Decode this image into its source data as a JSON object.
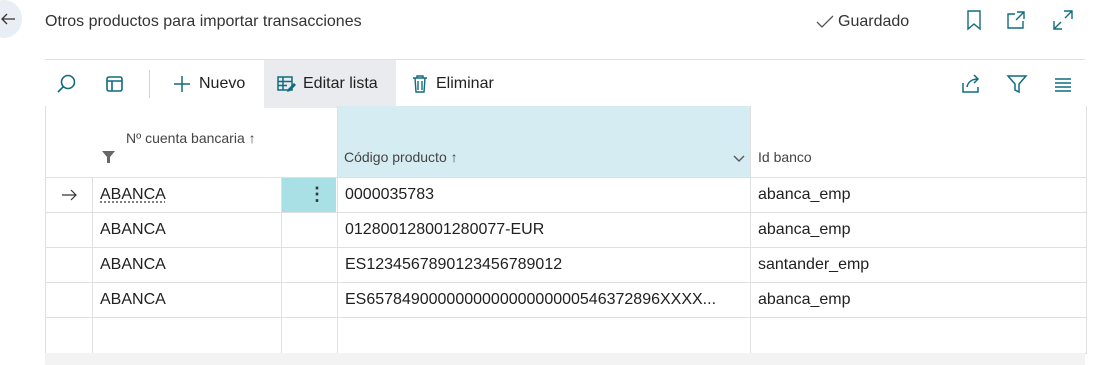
{
  "header": {
    "title": "Otros productos para importar transacciones",
    "saved_label": "Guardado"
  },
  "toolbar": {
    "new_label": "Nuevo",
    "edit_list_label": "Editar lista",
    "delete_label": "Eliminar"
  },
  "table": {
    "columns": [
      "Nº cuenta bancaria",
      "Código producto",
      "Id banco"
    ],
    "sort_glyph": "↑",
    "rows": [
      {
        "account": "ABANCA",
        "product": "0000035783",
        "bank": "abanca_emp"
      },
      {
        "account": "ABANCA",
        "product": "012800128001280077-EUR",
        "bank": "abanca_emp"
      },
      {
        "account": "ABANCA",
        "product": "ES1234567890123456789012",
        "bank": "santander_emp"
      },
      {
        "account": "ABANCA",
        "product": "ES657849000000000000000000546372896XXXX...",
        "bank": "abanca_emp"
      }
    ],
    "row_menu_glyph": "⋮"
  },
  "colors": {
    "accent": "#0f6c7e",
    "header_highlight": "#d5edf2",
    "menu_cell": "#a9e0e6"
  }
}
